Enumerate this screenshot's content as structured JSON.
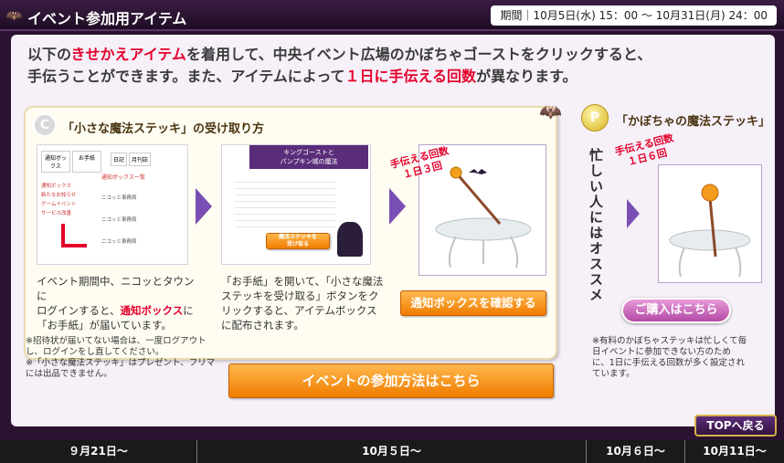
{
  "header": {
    "icon": "bat-icon",
    "title": "イベント参加用アイテム",
    "period": "期間｜10月5日(水) 15：00 ～ 10月31日(月) 24：00"
  },
  "intro": {
    "line1_a": "以下の",
    "line1_b": "きせかえアイテム",
    "line1_c": "を着用して、中央イベント広場のかぼちゃゴーストをクリックすると、",
    "line2_a": "手伝うことができます。また、アイテムによって",
    "line2_b": "１日に手伝える回数",
    "line2_c": "が異なります。"
  },
  "panel_free": {
    "step_icon": "C",
    "title": "「小さな魔法ステッキ」の受け取り方",
    "step1_desc_a": "イベント期間中、ニコッとタウンに",
    "step1_desc_b": "ログインすると、",
    "step1_desc_c": "通知ボックス",
    "step1_desc_d": "に",
    "step1_desc_e": "「お手紙」が届いています。",
    "step2_desc": "「お手紙」を開いて、「小さな魔法ステッキを受け取る」ボタンをクリックすると、アイテムボックスに配布されます。",
    "handwrite": "手伝える回数\n１日３回",
    "confirm_button": "通知ボックスを確認する",
    "thumb1_tabs": [
      "通知ボックス",
      "お手紙",
      "日記",
      "月刊誌"
    ],
    "thumb1_list_title": "通知ボックス一覧",
    "thumb1_items": [
      "通知ボックス",
      "新たなお知らせ",
      "ゲームイベント",
      "サービス改善"
    ],
    "thumb1_rows": [
      "ニコッと事務局",
      "ニコッと事務局",
      "ニコッと事務局"
    ],
    "thumb2_title": "キングゴーストと\nパンプキン城の魔法",
    "thumb2_button": "魔法ステッキを\n受け取る"
  },
  "notes_left": [
    "※招待状が届いてない場合は、一度ログアウトし、ログインをし直してください。",
    "※「小さな魔法ステッキ」はプレゼント、フリマには出品できません。"
  ],
  "event_button": "イベントの参加方法はこちら",
  "panel_paid": {
    "coin": "P",
    "title": "「かぼちゃの魔法ステッキ」",
    "vertical": "忙しい人にはオススメ",
    "handwrite": "手伝える回数\n１日６回",
    "buy_button": "ご購入はこちら",
    "note": "※有料のかぼちゃステッキは忙しくて毎日イベントに参加できない方のために、1日に手伝える回数が多く設定されています。"
  },
  "top_button": "TOPへ戻る",
  "timeline": [
    "９月21日～",
    "10月５日～",
    "10月６日～",
    "10月11日～"
  ],
  "colors": {
    "accent_red": "#e4002b",
    "purple": "#7a4fb3",
    "orange": "#f07c00"
  }
}
